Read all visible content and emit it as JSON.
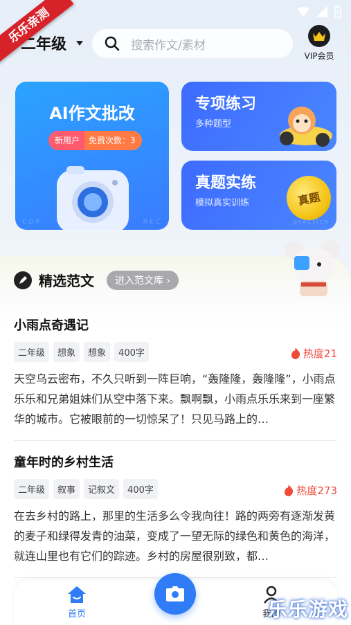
{
  "ribbon": "乐乐亲测",
  "header": {
    "grade": "二年级",
    "search_placeholder": "搜索作文/素材",
    "vip_label": "VIP会员"
  },
  "cards": {
    "ai": {
      "title": "AI作文批改",
      "pill_new": "新用户",
      "pill_free": "免费次数：3",
      "wm_left": "COR",
      "wm_right": "REC"
    },
    "special": {
      "title": "专项练习",
      "subtitle": "多种题型"
    },
    "real": {
      "title": "真题实练",
      "subtitle": "模拟真实训练",
      "coin": "真题",
      "wm": "practice"
    }
  },
  "section": {
    "title": "精选范文",
    "more": "进入范文库"
  },
  "articles": [
    {
      "title": "小雨点奇遇记",
      "tags": [
        "二年级",
        "想象",
        "想象",
        "400字"
      ],
      "heat": "热度21",
      "body": "天空乌云密布，不久只听到一阵巨响，“轰隆隆，轰隆隆”，小雨点乐乐和兄弟姐妹们从空中落下来。飘啊飘，小雨点乐乐来到一座繁华的城市。它被眼前的一切惊呆了！只见马路上的…"
    },
    {
      "title": "童年时的乡村生活",
      "tags": [
        "二年级",
        "叙事",
        "记叙文",
        "400字"
      ],
      "heat": "热度273",
      "body": "在去乡村的路上，那里的生活多么令我向往！路的两旁有逐渐发黄的麦子和绿得发青的油菜，变成了一望无际的绿色和黄色的海洋，就连山里也有它们的踪迹。乡村的房屋很别致，都…"
    }
  ],
  "nav": {
    "home": "首页",
    "mine": "我的"
  },
  "watermark": "乐乐游戏"
}
